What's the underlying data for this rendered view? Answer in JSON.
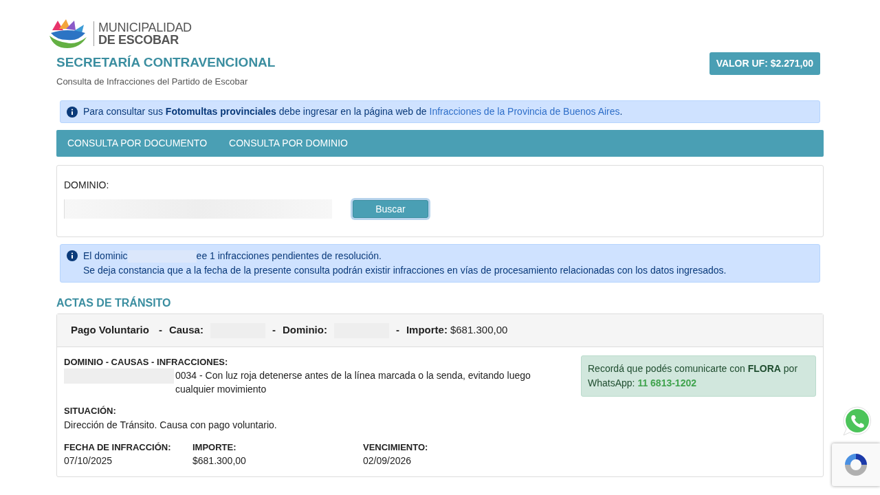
{
  "header": {
    "logo_lines": [
      "MUNICIPALIDAD",
      "DE ESCOBAR"
    ],
    "title": "SECRETARÍA CONTRAVENCIONAL",
    "subtitle": "Consulta de Infracciones del Partido de Escobar",
    "uf_badge": "VALOR UF: $2.271,00"
  },
  "notice": {
    "text": "Para consultar sus **Fotomultas provinciales** debe ingresar en la página web de ",
    "link": "Infracciones de la Provincia de Buenos Aires",
    "end": "."
  },
  "tabs": [
    {
      "label": "CONSULTA POR DOCUMENTO"
    },
    {
      "label": "CONSULTA POR DOMINIO"
    }
  ],
  "search": {
    "label": "DOMINIO:",
    "button": "Buscar"
  },
  "result_alert": {
    "line1_start": "El dominic",
    "line1_end": "ee 1 infracciones pendientes de resolución.",
    "line2": "Se deja constancia que a la fecha de la presente consulta podrán existir infracciones en vías de procesamiento relacionadas con los datos ingresados."
  },
  "section_title": "ACTAS DE TRÁNSITO",
  "acta": {
    "header": [
      {
        "kind": "bold",
        "text": "Pago Voluntario"
      },
      {
        "kind": "sep",
        "text": "-"
      },
      {
        "kind": "bold",
        "text": "Causa:"
      },
      {
        "kind": "redacted"
      },
      {
        "kind": "sep",
        "text": "-"
      },
      {
        "kind": "bold",
        "text": "Dominio:"
      },
      {
        "kind": "redacted"
      },
      {
        "kind": "sep",
        "text": "-"
      },
      {
        "kind": "bold",
        "text": "Importe:"
      },
      {
        "kind": "text",
        "text": "$681.300,00"
      }
    ],
    "infracciones_label": "DOMINIO - CAUSAS - INFRACCIONES:",
    "infracciones_text": "0034 - Con luz roja detenerse antes de la línea marcada o la senda, evitando luego cualquier movimiento",
    "situacion_label": "SITUACIÓN:",
    "situacion_text": "Dirección de Tránsito. Causa con pago voluntario.",
    "fields": [
      {
        "label": "FECHA DE INFRACCIÓN:",
        "value": "07/10/2025"
      },
      {
        "label": "IMPORTE:",
        "value": "$681.300,00"
      },
      {
        "label": "VENCIMIENTO:",
        "value": "02/09/2026"
      }
    ],
    "flora": {
      "text": "Recordá que podés comunicarte con **FLORA** por WhatsApp: ",
      "phone": "11 6813-1202"
    }
  }
}
